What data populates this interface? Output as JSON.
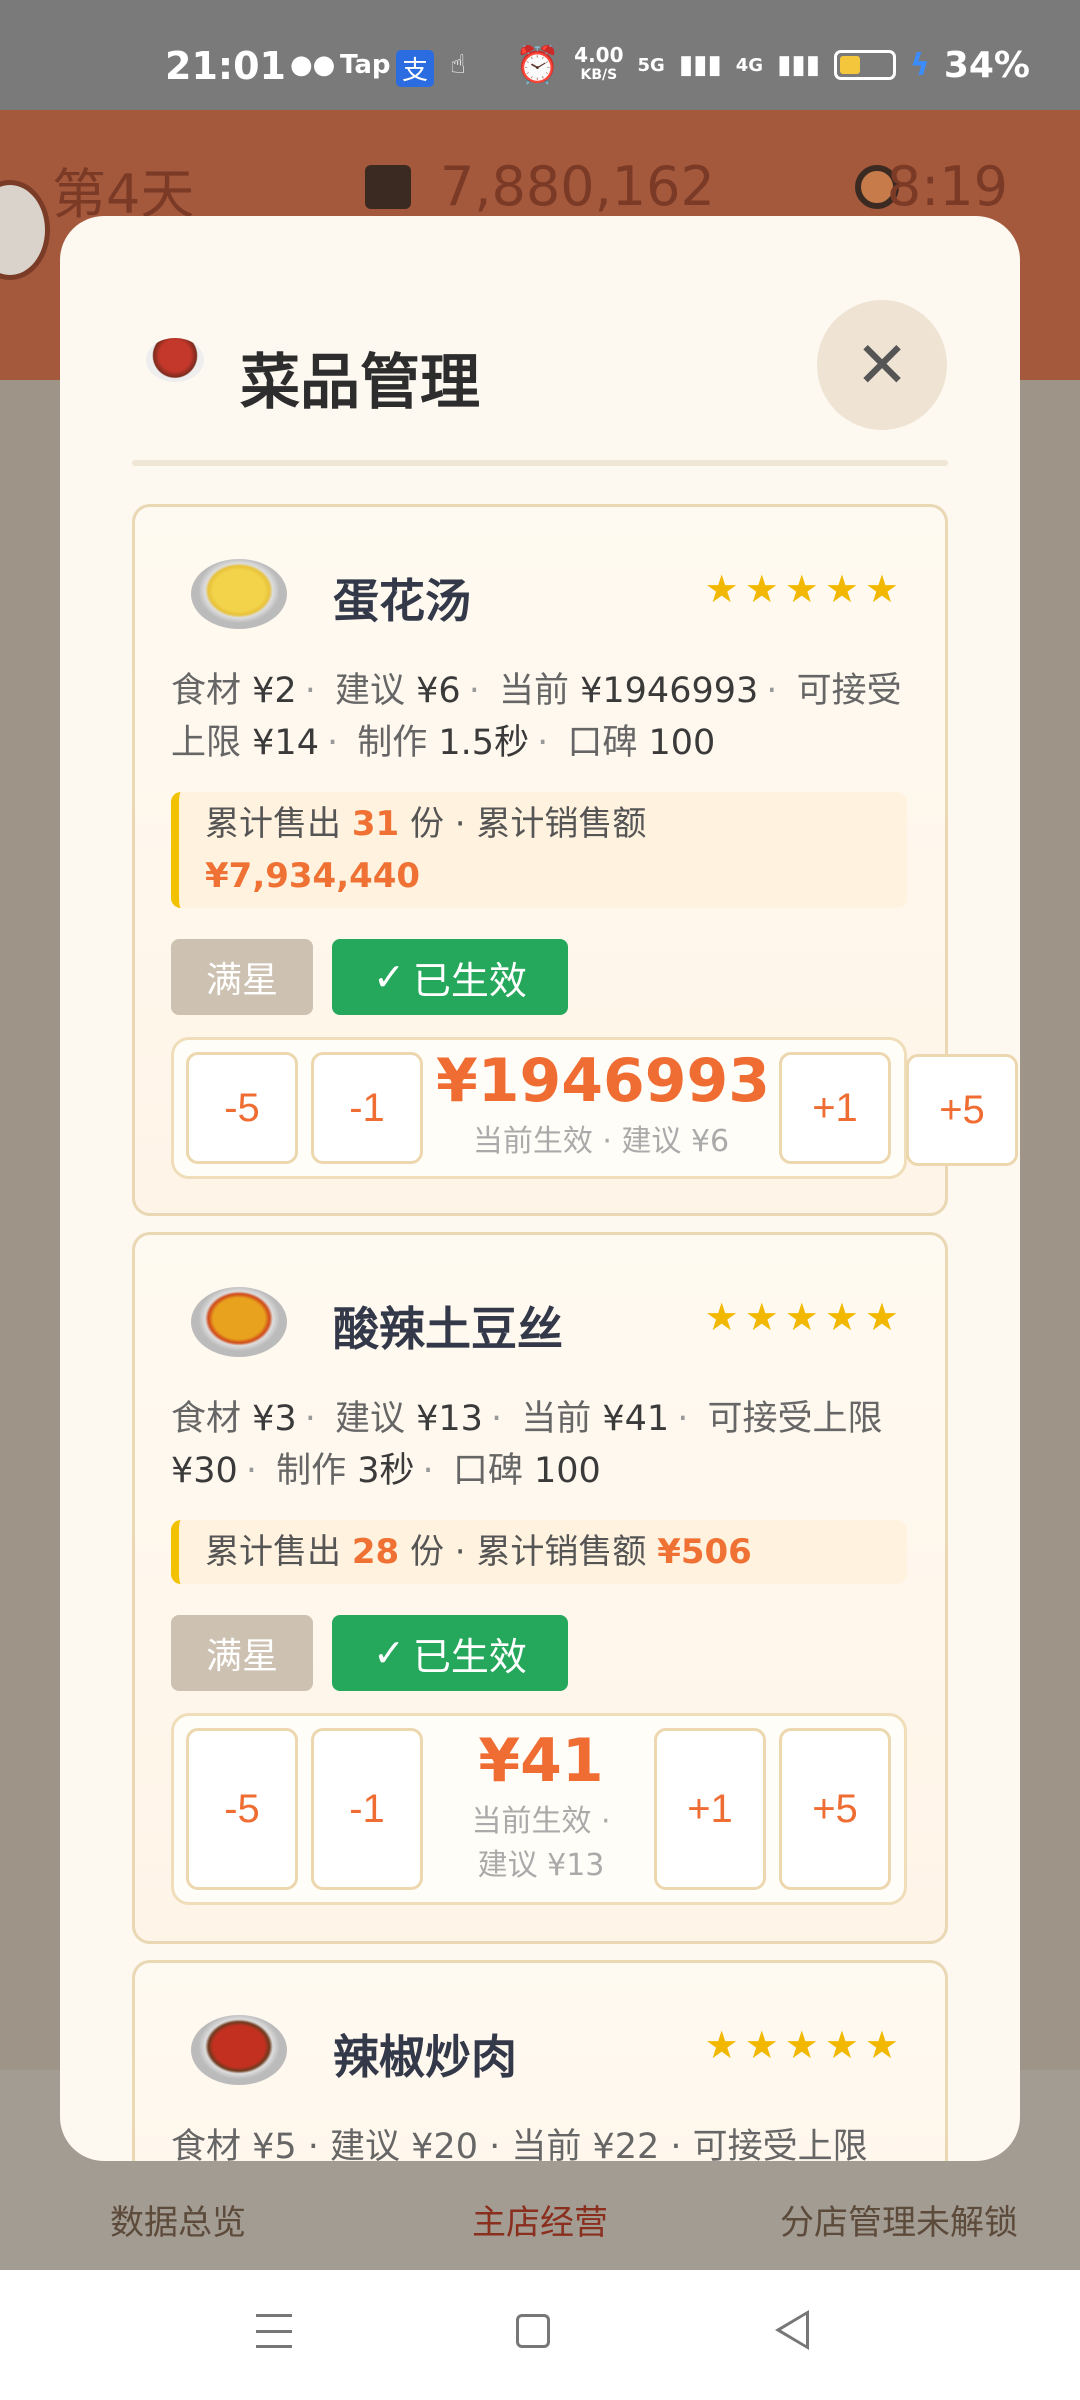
{
  "status_bar": {
    "time": "21:01",
    "net_speed_value": "4.00",
    "net_speed_unit": "KB/S",
    "net1": "5G",
    "net2": "4G",
    "battery": "34%"
  },
  "game": {
    "day": "第4天",
    "money": "7,880,162",
    "clock": "8:19",
    "bottom_nav": [
      "数据总览",
      "主店经营",
      "分店管理未解锁"
    ]
  },
  "modal": {
    "title": "菜品管理",
    "close_label": "✕",
    "dishes": [
      {
        "name": "蛋花汤",
        "stars": "★★★★★",
        "info": {
          "ingredient_label": "食材",
          "ingredient": "¥2",
          "suggest_label": "建议",
          "suggest": "¥6",
          "current_label": "当前",
          "current": "¥1946993",
          "limit_label": "可接受上限",
          "limit": "¥14",
          "make_label": "制作",
          "make": "1.5秒",
          "rep_label": "口碑",
          "rep": "100"
        },
        "sales": {
          "sold_label": "累计售出",
          "sold": "31",
          "unit": "份",
          "revenue_label": "累计销售额",
          "revenue": "¥7,934,440"
        },
        "tag_full": "满星",
        "tag_active": "已生效",
        "buttons": [
          "-5",
          "-1",
          "+1",
          "+5"
        ],
        "price": "¥1946993",
        "price_sub": "当前生效 · 建议 ¥6"
      },
      {
        "name": "酸辣土豆丝",
        "stars": "★★★★★",
        "info": {
          "ingredient_label": "食材",
          "ingredient": "¥3",
          "suggest_label": "建议",
          "suggest": "¥13",
          "current_label": "当前",
          "current": "¥41",
          "limit_label": "可接受上限",
          "limit": "¥30",
          "make_label": "制作",
          "make": "3秒",
          "rep_label": "口碑",
          "rep": "100"
        },
        "sales": {
          "sold_label": "累计售出",
          "sold": "28",
          "unit": "份",
          "revenue_label": "累计销售额",
          "revenue": "¥506"
        },
        "tag_full": "满星",
        "tag_active": "已生效",
        "buttons": [
          "-5",
          "-1",
          "+1",
          "+5"
        ],
        "price": "¥41",
        "price_sub_1": "当前生效 ·",
        "price_sub_2": "建议 ¥13"
      },
      {
        "name": "辣椒炒肉",
        "stars": "★★★★★",
        "info_partial": "食材 ¥5 · 建议 ¥20 · 当前 ¥22 · 可接受上限"
      }
    ]
  }
}
